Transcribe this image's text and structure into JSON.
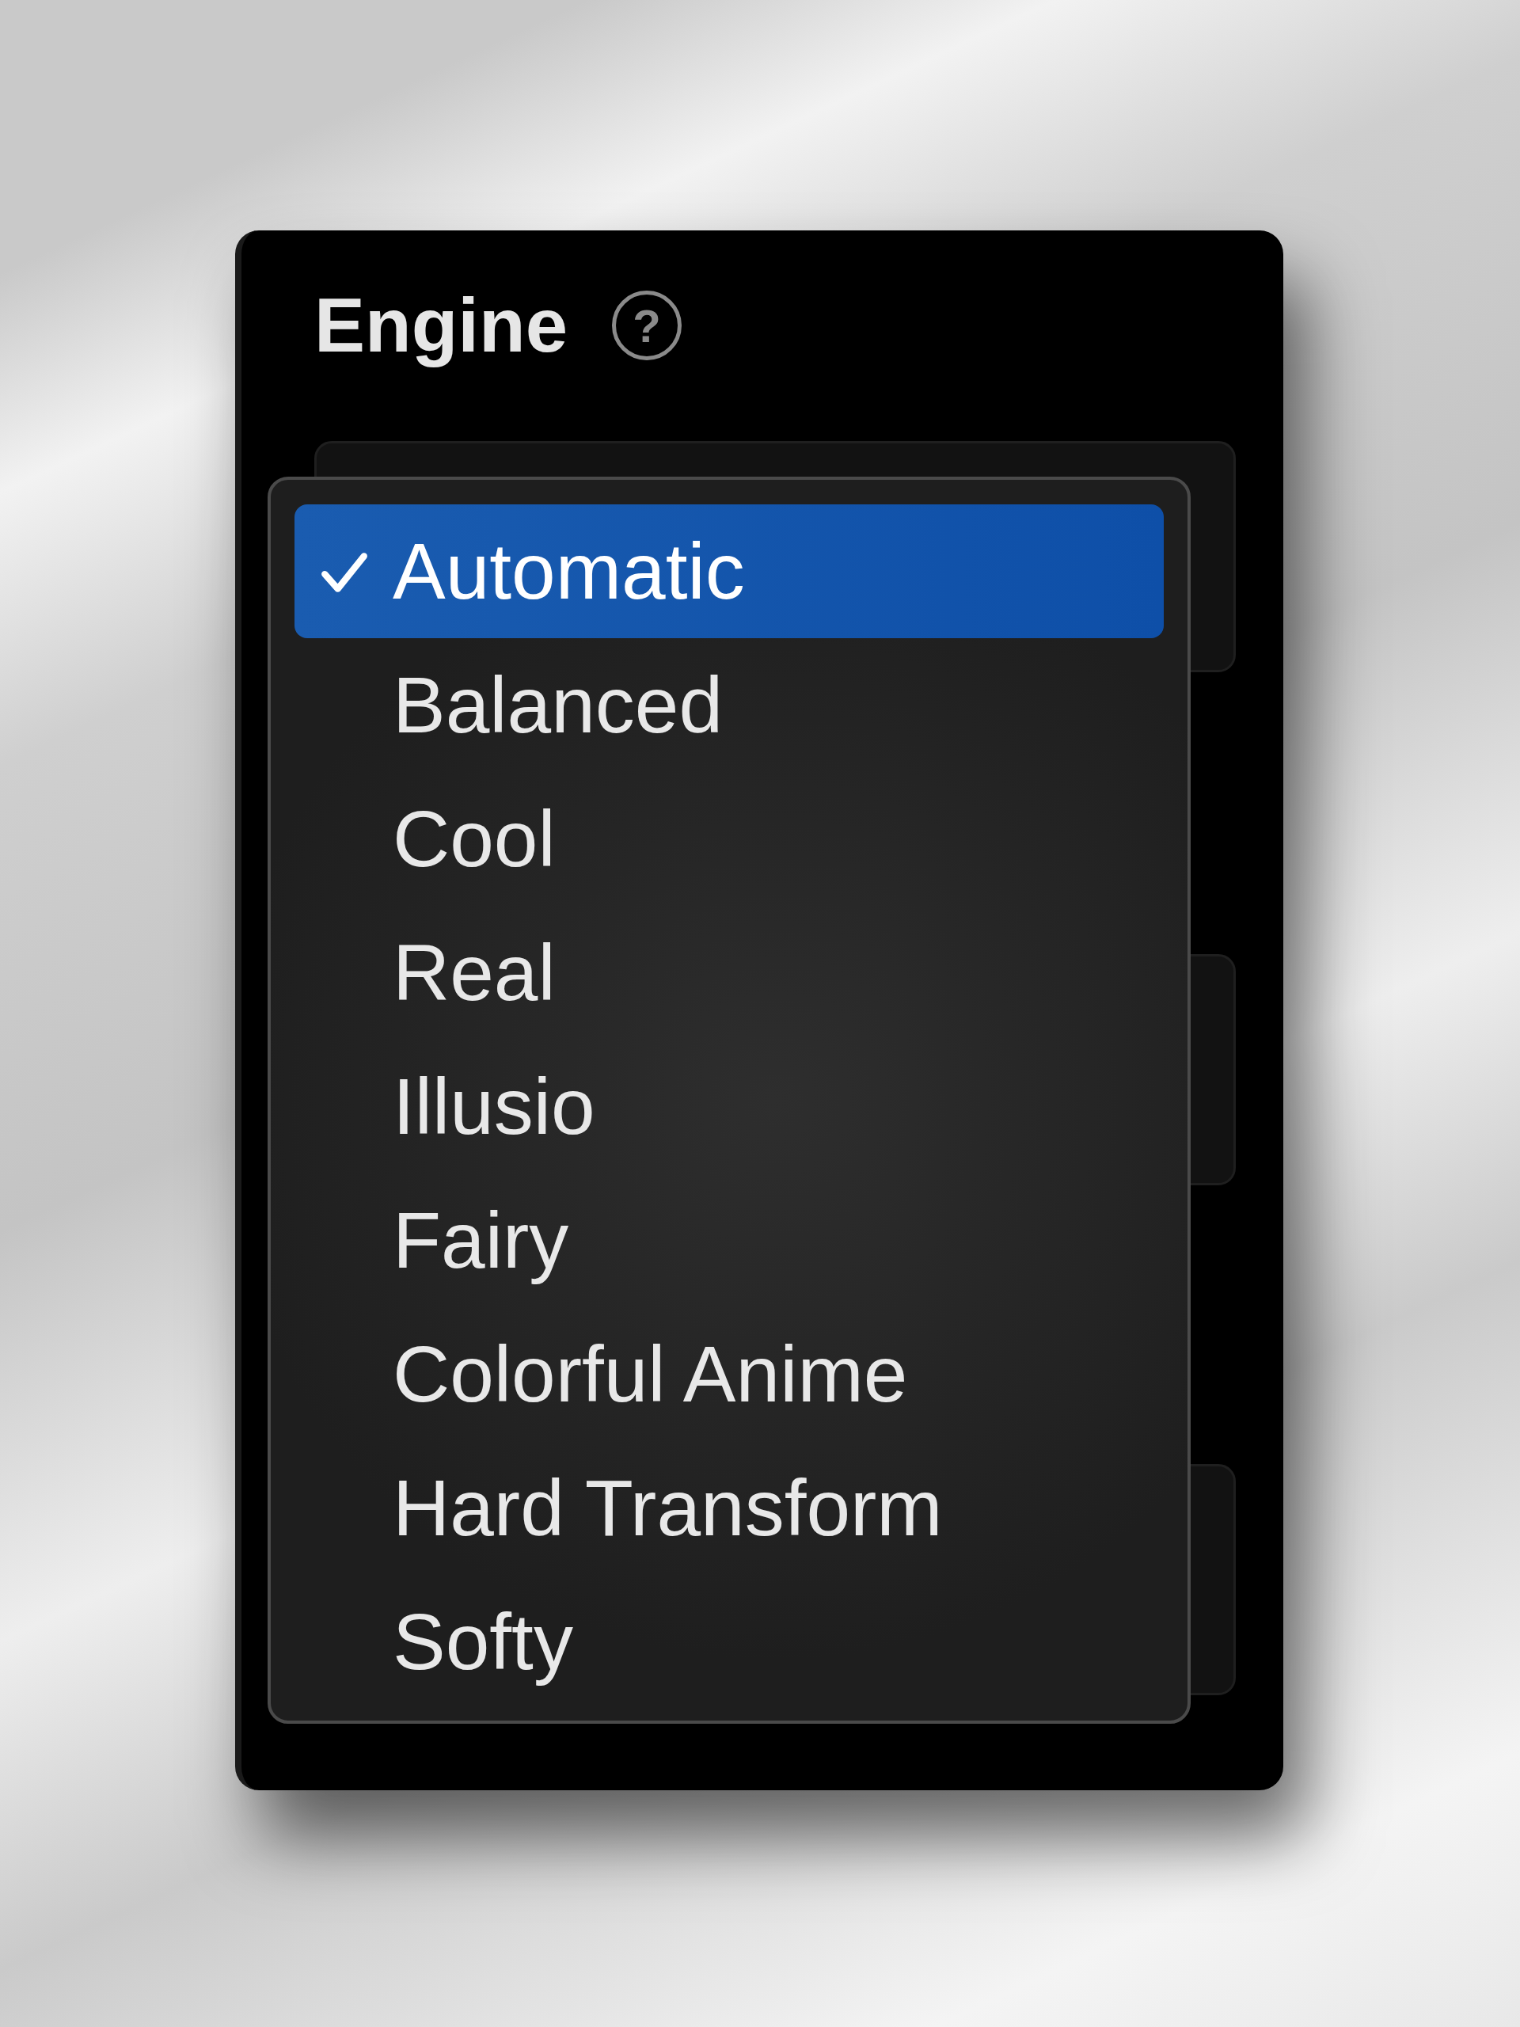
{
  "panel": {
    "title": "Engine",
    "help_icon": "?"
  },
  "menu": {
    "items": [
      {
        "label": "Automatic",
        "selected": true
      },
      {
        "label": "Balanced",
        "selected": false
      },
      {
        "label": "Cool",
        "selected": false
      },
      {
        "label": "Real",
        "selected": false
      },
      {
        "label": "Illusio",
        "selected": false
      },
      {
        "label": "Fairy",
        "selected": false
      },
      {
        "label": "Colorful Anime",
        "selected": false
      },
      {
        "label": "Hard Transform",
        "selected": false
      },
      {
        "label": "Softy",
        "selected": false
      }
    ]
  }
}
